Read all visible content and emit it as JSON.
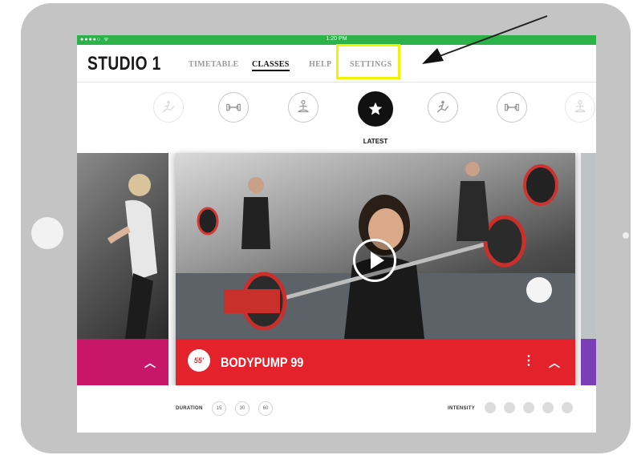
{
  "status_bar": {
    "signal": "●●●●○ ᯤ",
    "time": "1:20 PM"
  },
  "header": {
    "title": "STUDIO 1",
    "nav": [
      {
        "label": "TIMETABLE",
        "active": false
      },
      {
        "label": "CLASSES",
        "active": true
      },
      {
        "label": "HELP",
        "active": false
      },
      {
        "label": "SETTINGS",
        "active": false
      }
    ]
  },
  "categories": {
    "icons": [
      "kick-icon",
      "dumbbell-icon",
      "meditation-icon",
      "star-icon",
      "kick-icon",
      "dumbbell-icon",
      "meditation-icon"
    ],
    "active_label": "LATEST"
  },
  "featured": {
    "class_name": "BODYPUMP 99",
    "logo_text": "55'",
    "accent_color": "#e3222c",
    "left_card_color": "#c8176b",
    "right_card_color": "#7a3fb5"
  },
  "filters": {
    "duration_label": "DURATION",
    "durations": [
      "15",
      "30",
      "60"
    ],
    "intensity_label": "INTENSITY",
    "intensity_levels": 5
  },
  "colors": {
    "status_bar": "#2db24a",
    "highlight": "#f2f200"
  }
}
